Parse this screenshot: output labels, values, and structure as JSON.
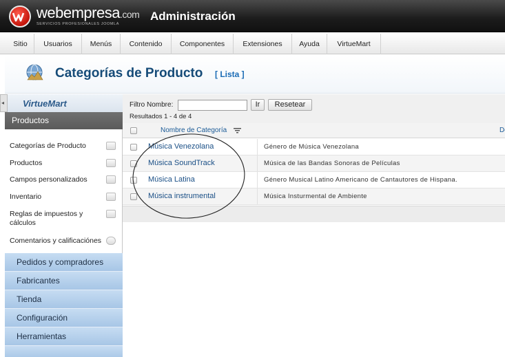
{
  "header": {
    "brand": "webempresa",
    "brand_suffix": ".com",
    "brand_tagline": "SERVICIOS PROFESIONALES JOOMLA",
    "title": "Administración"
  },
  "menu": [
    "Sitio",
    "Usuarios",
    "Menús",
    "Contenido",
    "Componentes",
    "Extensiones",
    "Ayuda",
    "VirtueMart"
  ],
  "page": {
    "title": "Categorías de Producto",
    "subtitle": "[ Lista ]"
  },
  "sidebar": {
    "logo": "VirtueMart",
    "section": "Productos",
    "links": [
      {
        "label": "Categorías de Producto",
        "icon": "folder-icon"
      },
      {
        "label": "Productos",
        "icon": "camera-icon"
      },
      {
        "label": "Campos personalizados",
        "icon": "copy-icon"
      },
      {
        "label": "Inventario",
        "icon": "edit-icon"
      },
      {
        "label": "Reglas de impuestos y cálculos",
        "icon": "calculator-icon"
      },
      {
        "label": "Comentarios y calificaciónes",
        "icon": "comment-icon"
      }
    ],
    "groups": [
      "Pedidos y compradores",
      "Fabricantes",
      "Tienda",
      "Configuración",
      "Herramientas"
    ]
  },
  "filter": {
    "label": "Filtro Nombre:",
    "value": "",
    "go": "Ir",
    "reset": "Resetear",
    "results": "Resultados 1 - 4 de 4"
  },
  "table": {
    "col_name": "Nombre de Categoría",
    "col_desc": "De",
    "rows": [
      {
        "name": "Música Venezolana",
        "description": "Género de Música Venezolana"
      },
      {
        "name": "Música SoundTrack",
        "description": "Música de las Bandas Sonoras de Películas"
      },
      {
        "name": "Música Latina",
        "description": "Género Musical Latino Americano de Cantautores de Hispana."
      },
      {
        "name": "Música instrumental",
        "description": "Música Insturmental de Ambiente"
      }
    ]
  },
  "colors": {
    "accent": "#154b78",
    "link": "#1a4f86",
    "sidebar_group": "#b4d0ec",
    "header_bg": "#1c1c1c",
    "logo_red": "#d0241a"
  }
}
